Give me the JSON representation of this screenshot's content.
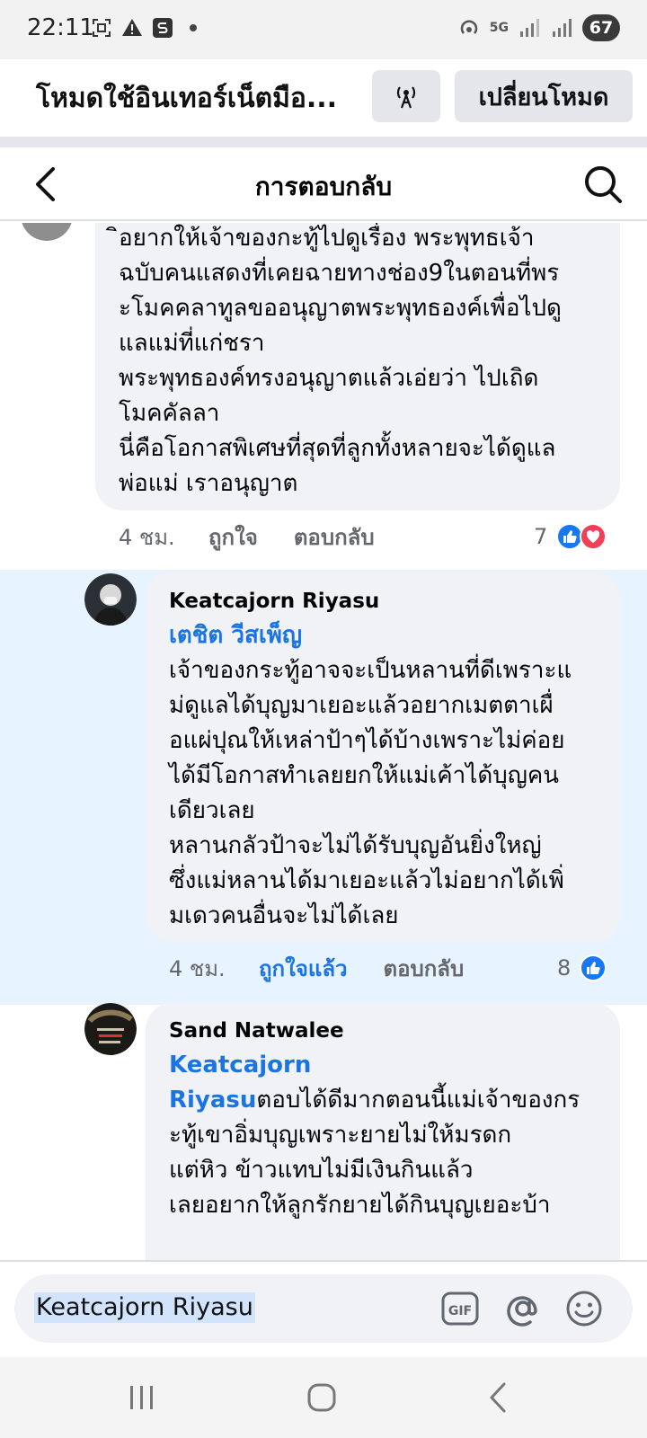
{
  "status": {
    "time": "22:11",
    "network": "5G",
    "battery": "67",
    "left_icons": [
      "screenshot-icon",
      "warning-icon",
      "s-app-icon",
      "dot-icon"
    ],
    "right_icons": [
      "hotspot-icon",
      "signal-icon",
      "signal-icon-2"
    ]
  },
  "mode_banner": {
    "text": "โหมดใช้อินเทอร์เน็ตมือ...",
    "switch_label": "เปลี่ยนโหมด"
  },
  "header": {
    "title": "การตอบกลับ"
  },
  "comments": [
    {
      "lines": [
        "ิอยากให้เจ้าของกะทู้ไปดูเรื่อง พระพุทธเจ้า",
        "ฉบับคนแสดงที่เคยฉายทางช่อง9ในตอนที่พร",
        "ะโมคคลาทูลขออนุญาตพระพุทธองค์เพื่อไปดู",
        "แลแม่ที่แก่ชรา",
        "พระพุทธองค์ทรงอนุญาตแล้วเอ่ยว่า ไปเถิด",
        "โมคคัลลา",
        "นี่คือโอกาสพิเศษที่สุดที่ลูกทั้งหลายจะได้ดูแล",
        "พ่อแม่   เราอนุญาต"
      ],
      "time": "4 ชม.",
      "like_label": "ถูกใจ",
      "reply_label": "ตอบกลับ",
      "reaction_count": "7"
    },
    {
      "author": "Keatcajorn Riyasu",
      "tag": "เตชิต วีสเพ็ญ",
      "lines": [
        "เจ้าของกระทู้อาจจะเป็นหลานที่ดีเพราะแ",
        "ม่ดูแลได้บุญมาเยอะแล้วอยากเมตตาเผื่",
        "อแผ่ปุณให้เหล่าป้าๆได้บ้างเพราะไม่ค่อย",
        "ได้มีโอกาสทำเลยยกให้แม่เค้าได้บุญคน",
        "เดียวเลย",
        "หลานกลัวป้าจะไม่ได้รับบุญอันยิ่งใหญ่",
        "ซึ่งแม่หลานได้มาเยอะแล้วไม่อยากได้เพิ่",
        "มเดวคนอื่นจะไม่ได้เลย"
      ],
      "time": "4 ชม.",
      "like_label": "ถูกใจแล้ว",
      "reply_label": "ตอบกลับ",
      "reaction_count": "8"
    },
    {
      "author": "Sand Natwalee",
      "tag_line1": "Keatcajorn",
      "tag_line2": "Riyasu",
      "line2_rest": "ตอบได้ดีมากตอนนี้แม่เจ้าของกร",
      "lines": [
        "ะทู้เขาอิ่มบุญเพราะยายไม่ให้มรดก",
        "แต่หิว ข้าวแทบไม่มีเงินกินแล้ว",
        "เลยอยากให้ลูกรักยายได้กินบุญเยอะบ้า"
      ]
    }
  ],
  "composer": {
    "value": "Keatcajorn Riyasu",
    "icons": [
      "gif-icon",
      "mention-icon",
      "emoji-icon"
    ]
  },
  "navbar": {
    "icons": [
      "recent-apps-icon",
      "home-icon",
      "back-nav-icon"
    ]
  },
  "colors": {
    "link_blue": "#1b74e4",
    "bubble_bg": "#f0f2f5",
    "highlight_bg": "#e7f3ff",
    "like_blue": "#1877f2",
    "love_red": "#f33e58"
  }
}
